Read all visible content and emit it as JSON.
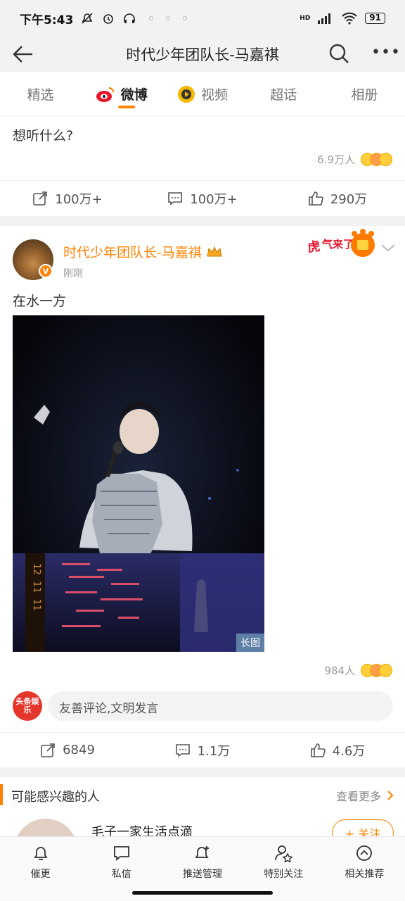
{
  "status": {
    "time": "下午5:43",
    "battery": "91",
    "network": "HD"
  },
  "nav": {
    "title": "时代少年团队长-马嘉祺"
  },
  "tabs": [
    {
      "label": "精选",
      "active": false
    },
    {
      "label": "微博",
      "active": true
    },
    {
      "label": "视频",
      "active": false
    },
    {
      "label": "超话",
      "active": false
    },
    {
      "label": "相册",
      "active": false
    }
  ],
  "post1": {
    "text": "想听什么?",
    "likes_people": "6.9万人",
    "actions": {
      "repost": "100万+",
      "comment": "100万+",
      "like": "290万"
    }
  },
  "post2": {
    "author": "时代少年团队长-马嘉祺",
    "time": "刚刚",
    "text": "在水一方",
    "image_tag": "长图",
    "likes_people": "984人",
    "comment_placeholder": "友善评论,文明发言",
    "commenter_logo": "头条娱乐",
    "actions": {
      "repost": "6849",
      "comment": "1.1万",
      "like": "4.6万"
    },
    "sticker_text": "虎气来了"
  },
  "recommend": {
    "title": "可能感兴趣的人",
    "more": "查看更多",
    "user_name": "毛子一家生活点滴",
    "follow": "+ 关注"
  },
  "bottom": [
    {
      "label": "催更",
      "icon": "bell-icon"
    },
    {
      "label": "私信",
      "icon": "message-icon"
    },
    {
      "label": "推送管理",
      "icon": "push-bell-icon"
    },
    {
      "label": "特别关注",
      "icon": "special-follow-icon"
    },
    {
      "label": "相关推荐",
      "icon": "recommend-icon"
    }
  ],
  "colors": {
    "accent": "#ff8200",
    "image_tag_bg": "#5d7fa6"
  }
}
